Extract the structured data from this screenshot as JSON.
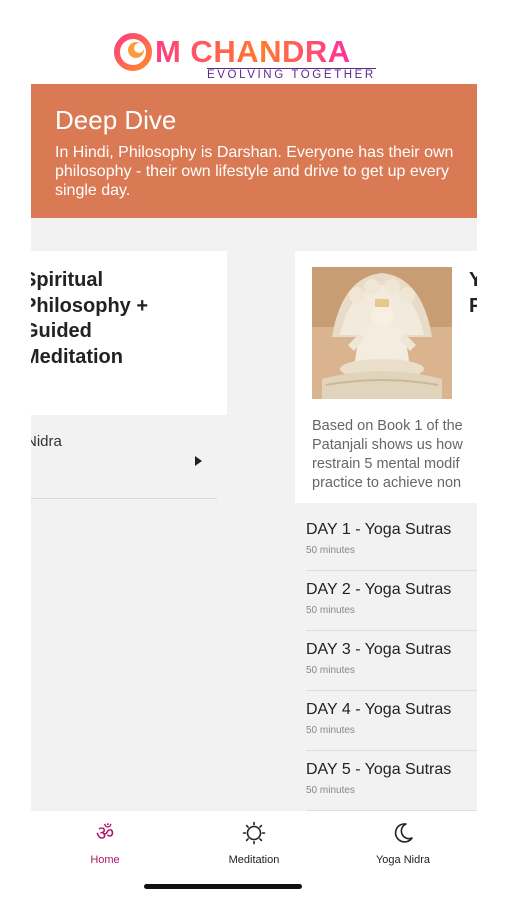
{
  "header": {
    "logo_text": "M CHANDRA",
    "logo_tagline": "EVOLVING TOGETHER",
    "brand_color": "#ff4f6e"
  },
  "banner": {
    "title": "Deep Dive",
    "description": "In Hindi, Philosophy is Darshan. Everyone has their own philosophy - their own lifestyle and drive to get up every single day.",
    "color": "#da7a54"
  },
  "cards": {
    "left": {
      "title_lines": [
        "Spiritual",
        "Philosophy +",
        "Guided",
        "Meditation"
      ],
      "item_label": "Nidra"
    },
    "right": {
      "title_lines": [
        "Y",
        "P"
      ],
      "image_icon": "deity-statue-image",
      "description_lines": [
        "Based on Book 1 of the",
        "Patanjali shows us how",
        "restrain 5 mental modif",
        "practice to achieve non"
      ]
    }
  },
  "days": [
    {
      "title": "DAY 1 - Yoga Sutras",
      "duration": "50 minutes"
    },
    {
      "title": "DAY 2 - Yoga Sutras",
      "duration": "50 minutes"
    },
    {
      "title": "DAY 3 - Yoga Sutras",
      "duration": "50 minutes"
    },
    {
      "title": "DAY 4 - Yoga Sutras",
      "duration": "50 minutes"
    },
    {
      "title": "DAY 5 - Yoga Sutras",
      "duration": "50 minutes"
    }
  ],
  "tabbar": {
    "home": {
      "label": "Home",
      "icon": "om-icon"
    },
    "meditation": {
      "label": "Meditation",
      "icon": "sun-icon"
    },
    "yoga_nidra": {
      "label": "Yoga Nidra",
      "icon": "moon-icon"
    },
    "active_color": "#b0156a"
  }
}
